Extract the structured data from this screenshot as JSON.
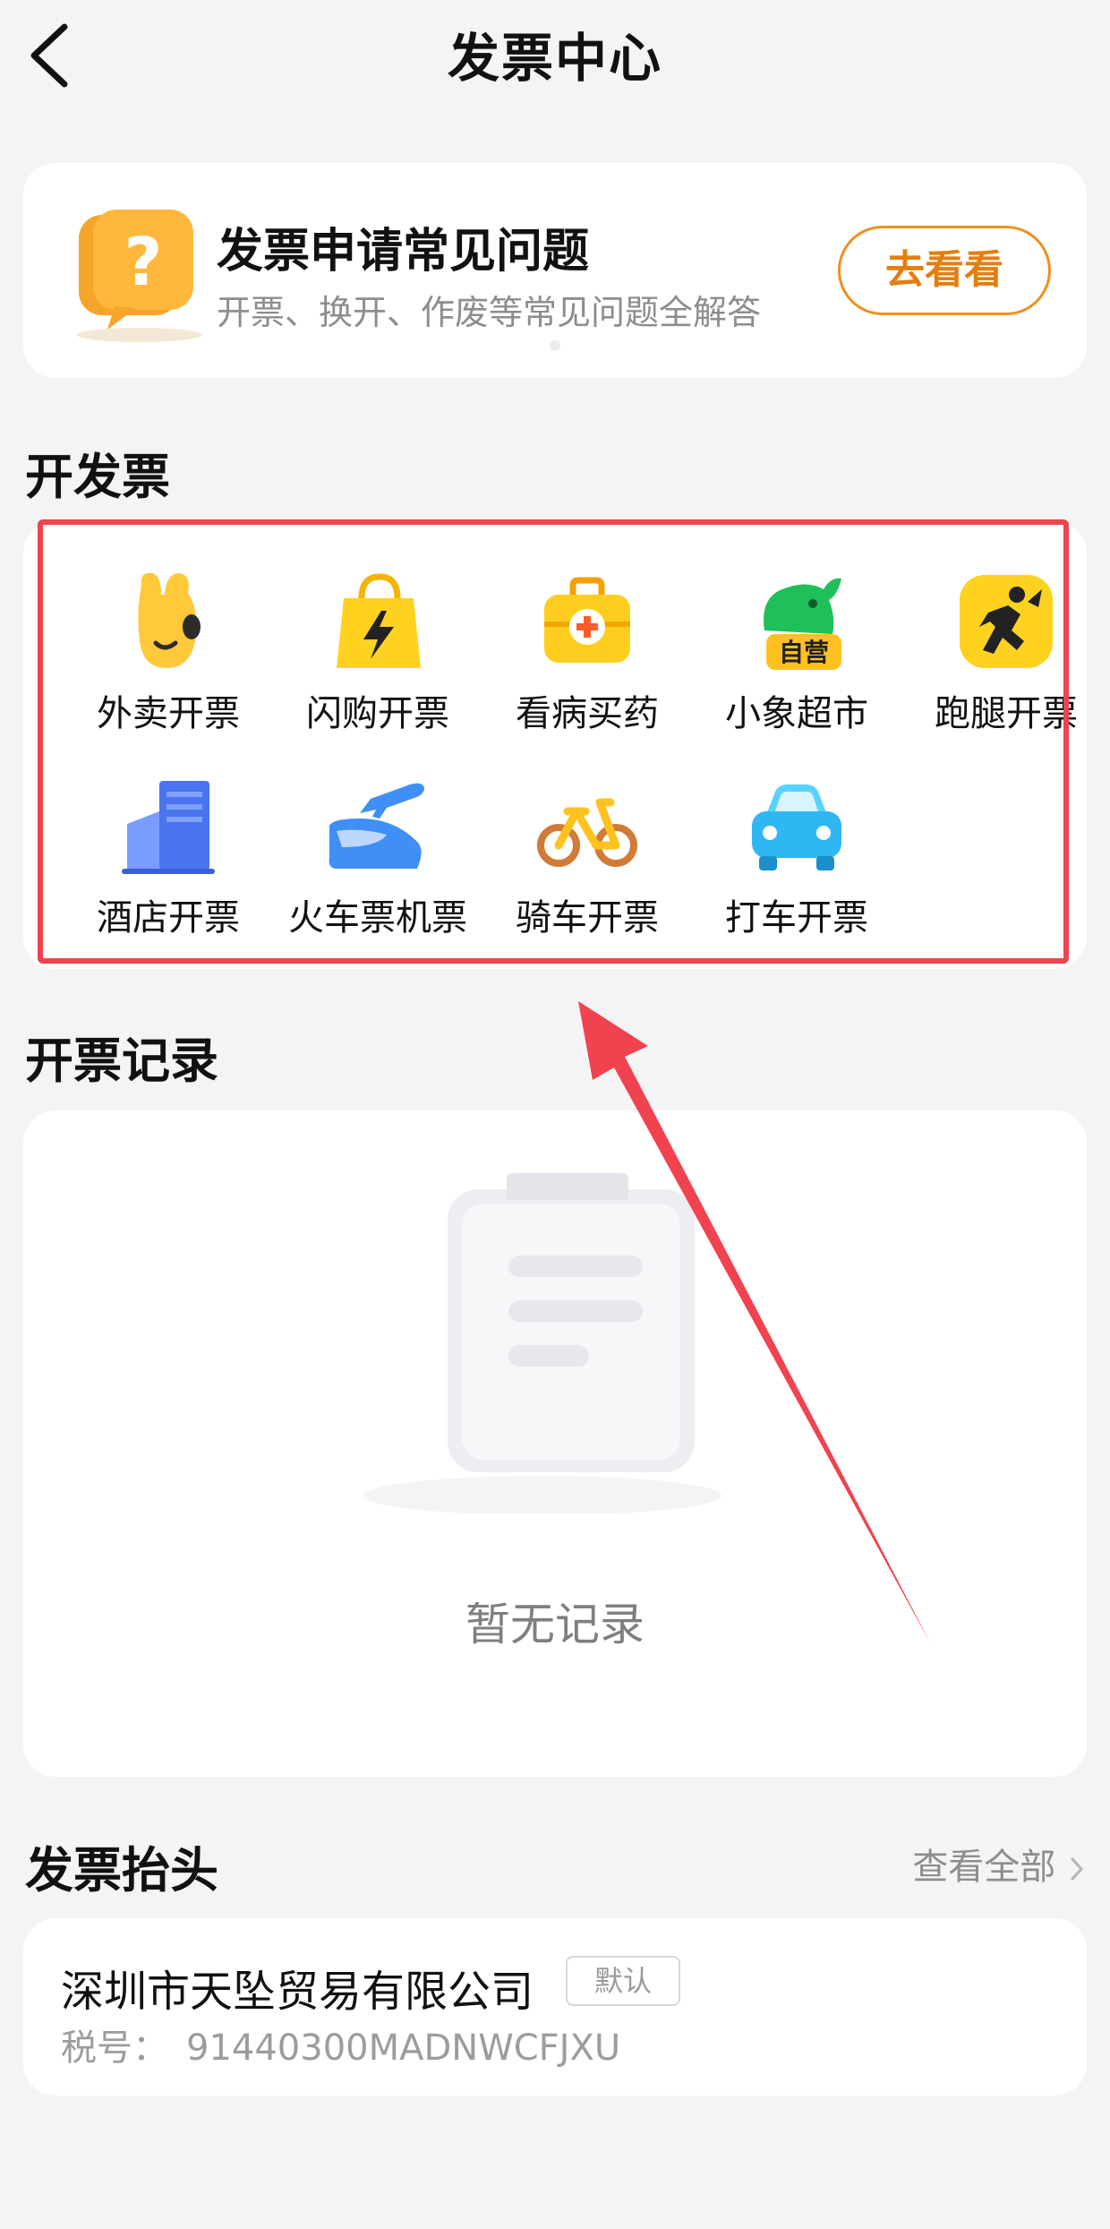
{
  "nav": {
    "title": "发票中心"
  },
  "faq": {
    "title": "发票申请常见问题",
    "subtitle": "开票、换开、作废等常见问题全解答",
    "button": "去看看"
  },
  "open_invoice": {
    "title": "开发票",
    "items": [
      {
        "label": "外卖开票",
        "icon": "waimai-rabbit-icon"
      },
      {
        "label": "闪购开票",
        "icon": "shopping-bag-bolt-icon"
      },
      {
        "label": "看病买药",
        "icon": "medical-kit-icon"
      },
      {
        "label": "小象超市",
        "icon": "elephant-icon",
        "badge": "自营"
      },
      {
        "label": "跑腿开票",
        "icon": "runner-icon"
      },
      {
        "label": "酒店开票",
        "icon": "hotel-building-icon"
      },
      {
        "label": "火车票机票",
        "icon": "train-plane-icon"
      },
      {
        "label": "骑车开票",
        "icon": "bicycle-icon"
      },
      {
        "label": "打车开票",
        "icon": "car-icon"
      }
    ]
  },
  "records": {
    "title": "开票记录",
    "empty_text": "暂无记录"
  },
  "invoice_header": {
    "title": "发票抬头",
    "view_all": "查看全部",
    "company": "深圳市天坠贸易有限公司",
    "default_badge": "默认",
    "tax_label": "税号：",
    "tax_number": "91440300MADNWCFJXU"
  },
  "colors": {
    "accent": "#ef8f1d",
    "highlight": "#f0434f",
    "brand_yellow": "#ffd21f"
  }
}
